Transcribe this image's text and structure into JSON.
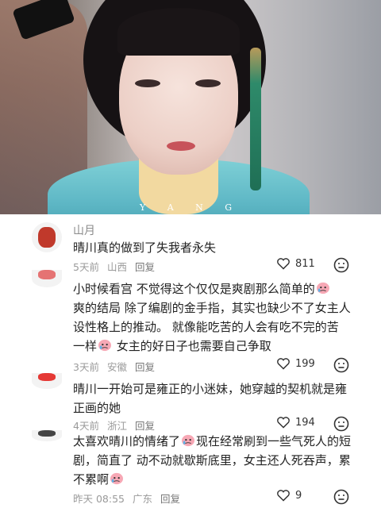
{
  "hero": {
    "watermark": "Y A N G"
  },
  "comments": [
    {
      "username": "山月",
      "text": "晴川真的做到了失我者永失",
      "time": "5天前",
      "location": "山西",
      "reply": "回复",
      "likes": "811"
    },
    {
      "username": "",
      "text1": "小时候看宫  不觉得这个仅仅是爽剧那么简单的",
      "text2": "爽的结局 除了编剧的金手指，其实也缺少不了女主人",
      "text3": "设性格上的推动。  就像能吃苦的人会有吃不完的苦",
      "text4a": "一样",
      "text4b": "  女主的好日子也需要自己争取",
      "time": "3天前",
      "location": "安徽",
      "reply": "回复",
      "likes": "199"
    },
    {
      "username": "",
      "text1": "晴川一开始可是雍正的小迷妹，她穿越的契机就是雍",
      "text2": "正画的她",
      "time": "4天前",
      "location": "浙江",
      "reply": "回复",
      "likes": "194"
    },
    {
      "username": "",
      "text1a": "太喜欢晴川的情绪了",
      "text1b": "现在经常刷到一些气死人的短",
      "text2": "剧，简直了 动不动就歇斯底里，女主还人死吞声，累",
      "text3": "不累啊",
      "time": "昨天 08:55",
      "location": "广东",
      "reply": "回复",
      "likes": "9"
    }
  ],
  "colors": {
    "heart": "#333333",
    "accent": "#e25b5b"
  },
  "icons": {
    "like": "heart-outline-icon",
    "dislike": "frown-face-icon",
    "emoji": "crying-emoji-icon"
  }
}
